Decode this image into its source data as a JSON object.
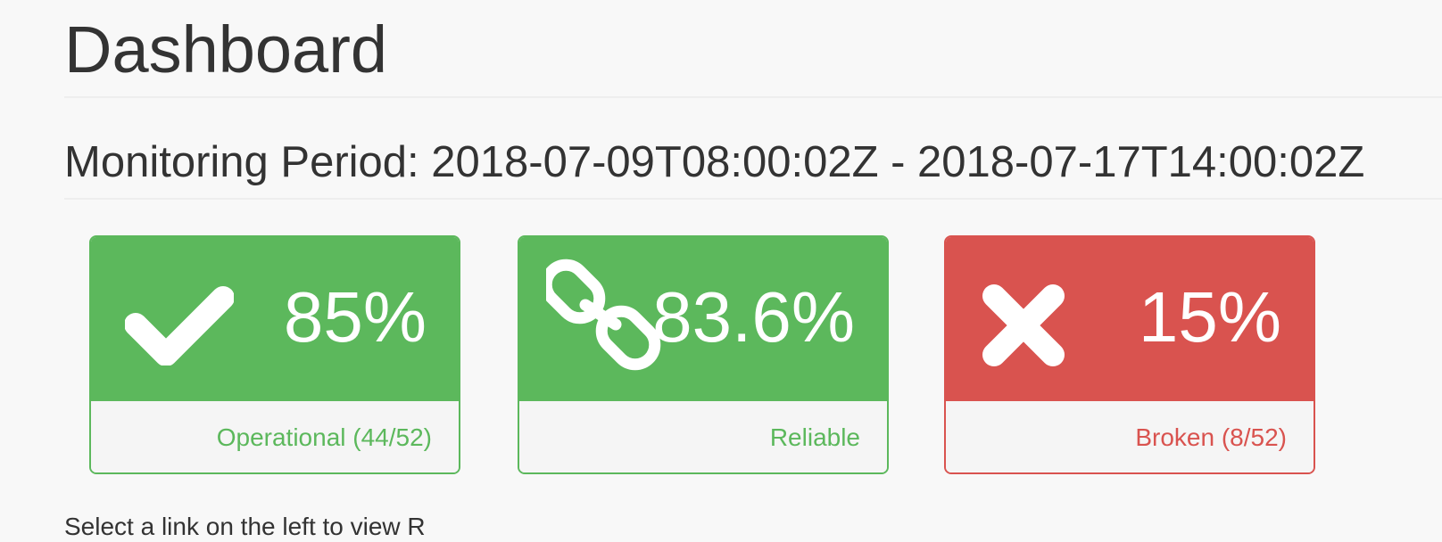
{
  "header": {
    "title": "Dashboard"
  },
  "period": {
    "text": "Monitoring Period: 2018-07-09T08:00:02Z - 2018-07-17T14:00:02Z"
  },
  "panels": [
    {
      "icon": "checkmark-icon",
      "value": "85%",
      "footer": "Operational (44/52)",
      "color": "#5cb85c"
    },
    {
      "icon": "chain-link-icon",
      "value": "83.6%",
      "footer": "Reliable",
      "color": "#5cb85c"
    },
    {
      "icon": "cross-icon",
      "value": "15%",
      "footer": "Broken (8/52)",
      "color": "#d9534f"
    }
  ],
  "bottom": {
    "text": "Select a link on the left to view R"
  }
}
